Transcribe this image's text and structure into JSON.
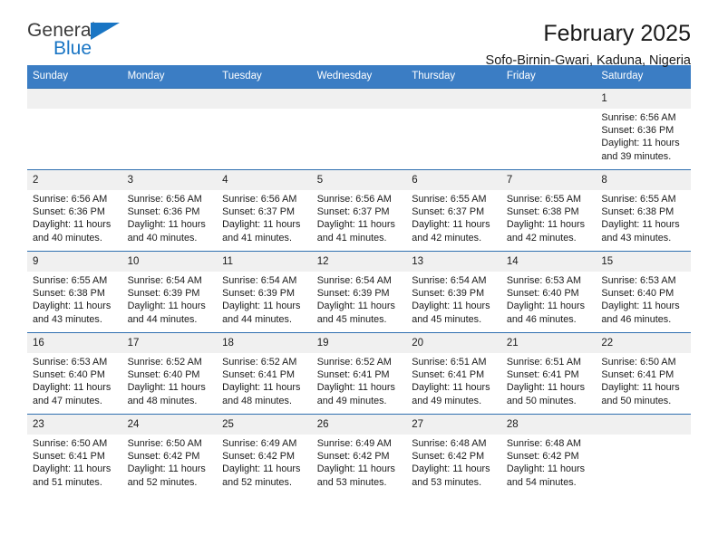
{
  "brand": {
    "name_top": "General",
    "name_bottom": "Blue",
    "accent_color": "#1975c4"
  },
  "header": {
    "title": "February 2025",
    "subtitle": "Sofo-Birnin-Gwari, Kaduna, Nigeria"
  },
  "theme": {
    "header_row_bg": "#3b7dc4",
    "daynum_bg": "#f0f0f0",
    "text_color": "#1a1a1a"
  },
  "weekday_headers": [
    "Sunday",
    "Monday",
    "Tuesday",
    "Wednesday",
    "Thursday",
    "Friday",
    "Saturday"
  ],
  "labels": {
    "sunrise_prefix": "Sunrise: ",
    "sunset_prefix": "Sunset: ",
    "daylight_prefix": "Daylight: "
  },
  "weeks": [
    [
      {
        "day": "",
        "empty": true
      },
      {
        "day": "",
        "empty": true
      },
      {
        "day": "",
        "empty": true
      },
      {
        "day": "",
        "empty": true
      },
      {
        "day": "",
        "empty": true
      },
      {
        "day": "",
        "empty": true
      },
      {
        "day": "1",
        "sunrise": "Sunrise: 6:56 AM",
        "sunset": "Sunset: 6:36 PM",
        "daylight": "Daylight: 11 hours and 39 minutes."
      }
    ],
    [
      {
        "day": "2",
        "sunrise": "Sunrise: 6:56 AM",
        "sunset": "Sunset: 6:36 PM",
        "daylight": "Daylight: 11 hours and 40 minutes."
      },
      {
        "day": "3",
        "sunrise": "Sunrise: 6:56 AM",
        "sunset": "Sunset: 6:36 PM",
        "daylight": "Daylight: 11 hours and 40 minutes."
      },
      {
        "day": "4",
        "sunrise": "Sunrise: 6:56 AM",
        "sunset": "Sunset: 6:37 PM",
        "daylight": "Daylight: 11 hours and 41 minutes."
      },
      {
        "day": "5",
        "sunrise": "Sunrise: 6:56 AM",
        "sunset": "Sunset: 6:37 PM",
        "daylight": "Daylight: 11 hours and 41 minutes."
      },
      {
        "day": "6",
        "sunrise": "Sunrise: 6:55 AM",
        "sunset": "Sunset: 6:37 PM",
        "daylight": "Daylight: 11 hours and 42 minutes."
      },
      {
        "day": "7",
        "sunrise": "Sunrise: 6:55 AM",
        "sunset": "Sunset: 6:38 PM",
        "daylight": "Daylight: 11 hours and 42 minutes."
      },
      {
        "day": "8",
        "sunrise": "Sunrise: 6:55 AM",
        "sunset": "Sunset: 6:38 PM",
        "daylight": "Daylight: 11 hours and 43 minutes."
      }
    ],
    [
      {
        "day": "9",
        "sunrise": "Sunrise: 6:55 AM",
        "sunset": "Sunset: 6:38 PM",
        "daylight": "Daylight: 11 hours and 43 minutes."
      },
      {
        "day": "10",
        "sunrise": "Sunrise: 6:54 AM",
        "sunset": "Sunset: 6:39 PM",
        "daylight": "Daylight: 11 hours and 44 minutes."
      },
      {
        "day": "11",
        "sunrise": "Sunrise: 6:54 AM",
        "sunset": "Sunset: 6:39 PM",
        "daylight": "Daylight: 11 hours and 44 minutes."
      },
      {
        "day": "12",
        "sunrise": "Sunrise: 6:54 AM",
        "sunset": "Sunset: 6:39 PM",
        "daylight": "Daylight: 11 hours and 45 minutes."
      },
      {
        "day": "13",
        "sunrise": "Sunrise: 6:54 AM",
        "sunset": "Sunset: 6:39 PM",
        "daylight": "Daylight: 11 hours and 45 minutes."
      },
      {
        "day": "14",
        "sunrise": "Sunrise: 6:53 AM",
        "sunset": "Sunset: 6:40 PM",
        "daylight": "Daylight: 11 hours and 46 minutes."
      },
      {
        "day": "15",
        "sunrise": "Sunrise: 6:53 AM",
        "sunset": "Sunset: 6:40 PM",
        "daylight": "Daylight: 11 hours and 46 minutes."
      }
    ],
    [
      {
        "day": "16",
        "sunrise": "Sunrise: 6:53 AM",
        "sunset": "Sunset: 6:40 PM",
        "daylight": "Daylight: 11 hours and 47 minutes."
      },
      {
        "day": "17",
        "sunrise": "Sunrise: 6:52 AM",
        "sunset": "Sunset: 6:40 PM",
        "daylight": "Daylight: 11 hours and 48 minutes."
      },
      {
        "day": "18",
        "sunrise": "Sunrise: 6:52 AM",
        "sunset": "Sunset: 6:41 PM",
        "daylight": "Daylight: 11 hours and 48 minutes."
      },
      {
        "day": "19",
        "sunrise": "Sunrise: 6:52 AM",
        "sunset": "Sunset: 6:41 PM",
        "daylight": "Daylight: 11 hours and 49 minutes."
      },
      {
        "day": "20",
        "sunrise": "Sunrise: 6:51 AM",
        "sunset": "Sunset: 6:41 PM",
        "daylight": "Daylight: 11 hours and 49 minutes."
      },
      {
        "day": "21",
        "sunrise": "Sunrise: 6:51 AM",
        "sunset": "Sunset: 6:41 PM",
        "daylight": "Daylight: 11 hours and 50 minutes."
      },
      {
        "day": "22",
        "sunrise": "Sunrise: 6:50 AM",
        "sunset": "Sunset: 6:41 PM",
        "daylight": "Daylight: 11 hours and 50 minutes."
      }
    ],
    [
      {
        "day": "23",
        "sunrise": "Sunrise: 6:50 AM",
        "sunset": "Sunset: 6:41 PM",
        "daylight": "Daylight: 11 hours and 51 minutes."
      },
      {
        "day": "24",
        "sunrise": "Sunrise: 6:50 AM",
        "sunset": "Sunset: 6:42 PM",
        "daylight": "Daylight: 11 hours and 52 minutes."
      },
      {
        "day": "25",
        "sunrise": "Sunrise: 6:49 AM",
        "sunset": "Sunset: 6:42 PM",
        "daylight": "Daylight: 11 hours and 52 minutes."
      },
      {
        "day": "26",
        "sunrise": "Sunrise: 6:49 AM",
        "sunset": "Sunset: 6:42 PM",
        "daylight": "Daylight: 11 hours and 53 minutes."
      },
      {
        "day": "27",
        "sunrise": "Sunrise: 6:48 AM",
        "sunset": "Sunset: 6:42 PM",
        "daylight": "Daylight: 11 hours and 53 minutes."
      },
      {
        "day": "28",
        "sunrise": "Sunrise: 6:48 AM",
        "sunset": "Sunset: 6:42 PM",
        "daylight": "Daylight: 11 hours and 54 minutes."
      },
      {
        "day": "",
        "empty": true
      }
    ]
  ]
}
